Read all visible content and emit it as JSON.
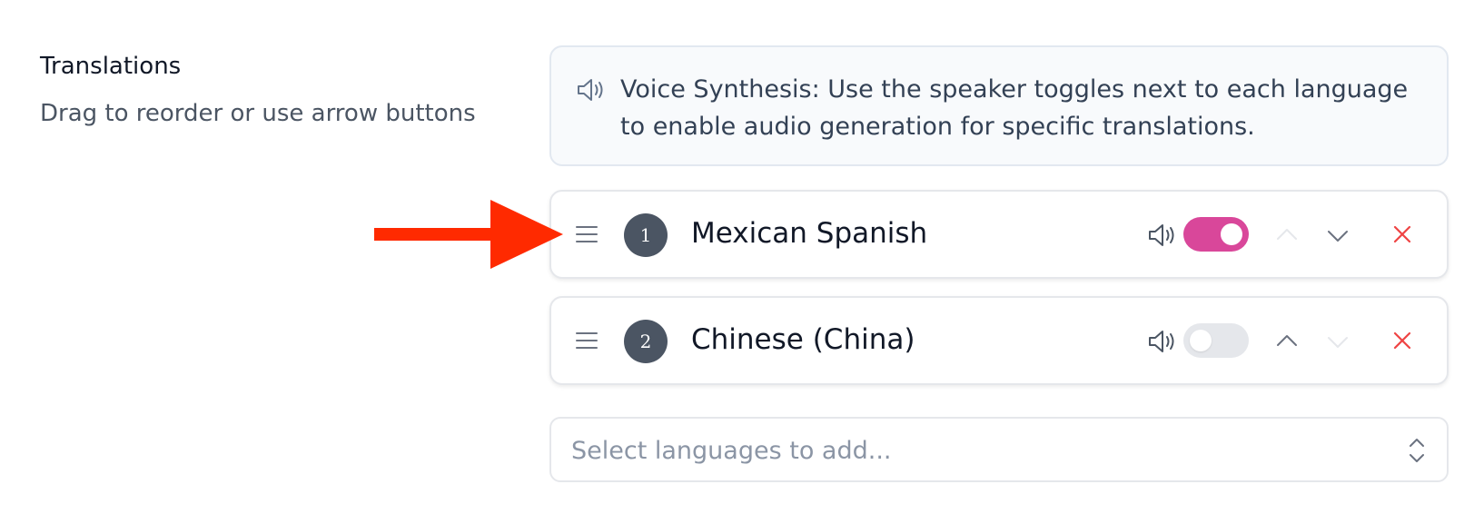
{
  "section": {
    "title": "Translations",
    "description": "Drag to reorder or use arrow buttons"
  },
  "info": {
    "icon": "speaker-icon",
    "text": "Voice Synthesis: Use the speaker toggles next to each language to enable audio generation for specific translations."
  },
  "languages": [
    {
      "index": "1",
      "name": "Mexican Spanish",
      "voice_enabled": true,
      "up_enabled": false,
      "down_enabled": true
    },
    {
      "index": "2",
      "name": "Chinese (China)",
      "voice_enabled": false,
      "up_enabled": true,
      "down_enabled": false
    }
  ],
  "select": {
    "placeholder": "Select languages to add..."
  },
  "colors": {
    "toggle_on": "#d9479a",
    "toggle_off": "#e5e7eb",
    "remove": "#ef4444",
    "badge": "#4b5563",
    "annotation_arrow": "#ff2a00"
  }
}
